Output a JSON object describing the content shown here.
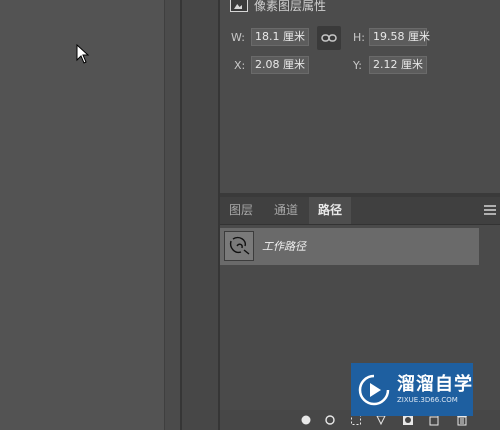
{
  "properties": {
    "title": "像素图层属性",
    "w_label": "W:",
    "w_value": "18.1 厘米",
    "h_label": "H:",
    "h_value": "19.58 厘米",
    "x_label": "X:",
    "x_value": "2.08 厘米",
    "y_label": "Y:",
    "y_value": "2.12 厘米"
  },
  "tabs": [
    {
      "label": "图层"
    },
    {
      "label": "通道"
    },
    {
      "label": "路径",
      "active": true
    }
  ],
  "paths": [
    {
      "name": "工作路径",
      "selected": true
    }
  ],
  "watermark": {
    "brand": "溜溜自学",
    "url": "ZIXUE.3D66.COM"
  },
  "colors": {
    "panel_bg": "#4a4a4a",
    "selected_row": "#6a6a6a",
    "watermark_bg": "#1e5fa0"
  }
}
